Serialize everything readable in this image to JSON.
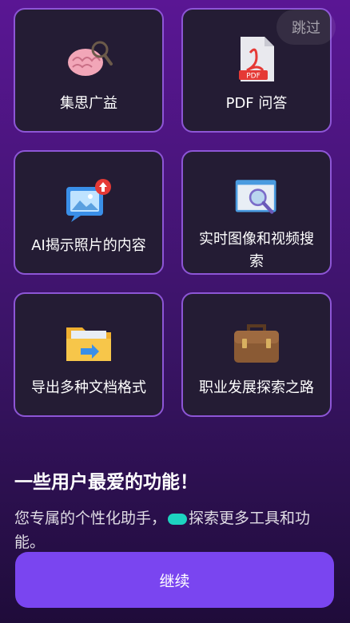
{
  "skip_label": "跳过",
  "features": [
    {
      "label": "集思广益",
      "icon": "brain-magnifier-icon"
    },
    {
      "label": "PDF 问答",
      "icon": "pdf-file-icon",
      "pdf_text": "PDF"
    },
    {
      "label": "AI揭示照片的内容",
      "icon": "image-upload-icon"
    },
    {
      "label": "实时图像和视频搜索",
      "icon": "window-search-icon"
    },
    {
      "label": "导出多种文档格式",
      "icon": "folder-export-icon"
    },
    {
      "label": "职业发展探索之路",
      "icon": "briefcase-icon"
    }
  ],
  "headline": "一些用户最爱的功能！",
  "description_before": "您专属的个性化助手，",
  "description_after": "探索更多工具和功能。",
  "continue_label": "继续",
  "colors": {
    "card_border": "#8d56d6",
    "card_bg": "#241c34",
    "button": "#7a45f0",
    "accent_bubble": "#1dd3c0"
  }
}
